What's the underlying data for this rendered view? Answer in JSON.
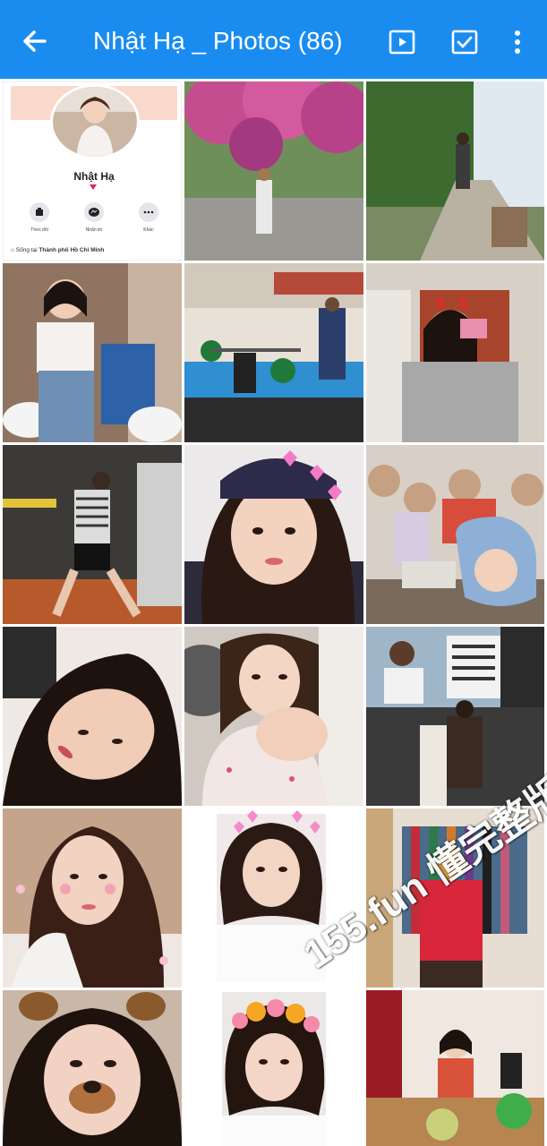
{
  "appbar": {
    "title": "Nhật Hạ _ Photos (86)",
    "bg_color": "#1a8cf0",
    "back_icon": "arrow-left-icon",
    "slideshow_icon": "play-box-icon",
    "select_icon": "checkbox-icon",
    "more_icon": "more-vertical-icon"
  },
  "profile_tile": {
    "name": "Nhật Hạ",
    "actions": [
      {
        "label": "Theo dõi",
        "icon": "follow-icon"
      },
      {
        "label": "Nhắn tin",
        "icon": "messenger-icon"
      },
      {
        "label": "Khác",
        "icon": "more-horizontal-icon"
      }
    ],
    "lives_in_prefix": "Sống tại",
    "lives_in_city": "Thành phố Hồ Chí Minh"
  },
  "photos": [
    {
      "id": "flowers-street"
    },
    {
      "id": "garden-walk"
    },
    {
      "id": "mirror-selfie-offtop"
    },
    {
      "id": "gym-weightlifting"
    },
    {
      "id": "mirror-selfie-devil-filter"
    },
    {
      "id": "gym-lunge"
    },
    {
      "id": "hearts-filter-selfie"
    },
    {
      "id": "group-selfie"
    },
    {
      "id": "lying-selfie"
    },
    {
      "id": "close-selfie"
    },
    {
      "id": "store-poster"
    },
    {
      "id": "bunny-filter-selfie"
    },
    {
      "id": "hearts-crown-selfie"
    },
    {
      "id": "clothing-store"
    },
    {
      "id": "puppy-filter-selfie"
    },
    {
      "id": "flower-crown-selfie"
    },
    {
      "id": "room-selfie"
    }
  ],
  "watermark": "155.fun 懂完整版"
}
